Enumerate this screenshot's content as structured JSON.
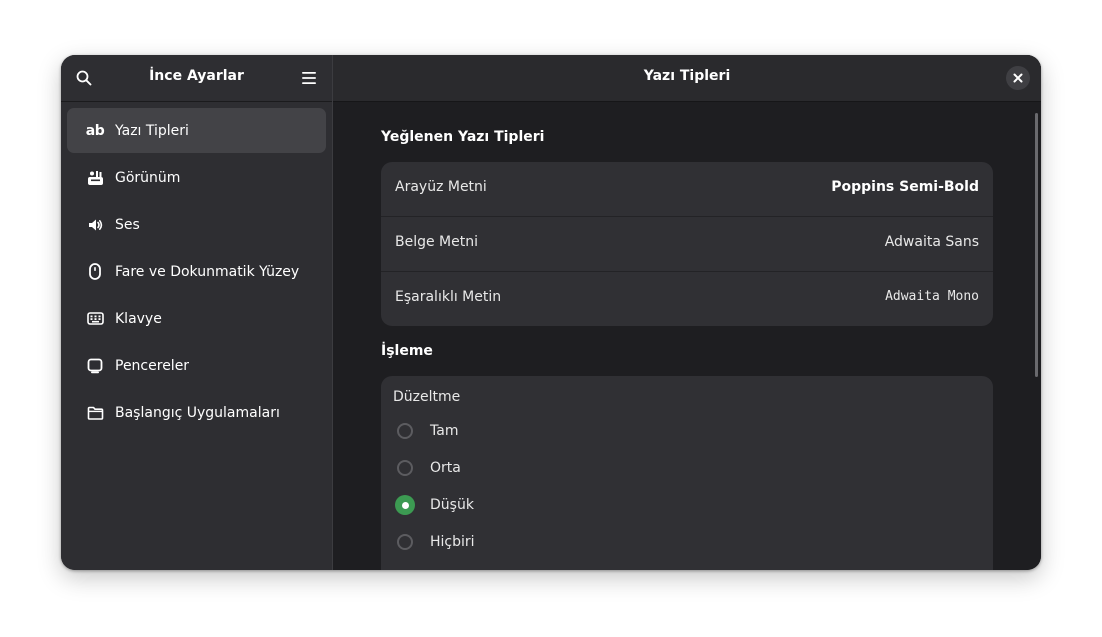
{
  "sidebar": {
    "title": "İnce Ayarlar",
    "search_icon": "search-icon",
    "menu_icon": "hamburger-menu-icon",
    "items": [
      {
        "label": "Yazı Tipleri",
        "icon": "font-ab-icon",
        "selected": true
      },
      {
        "label": "Görünüm",
        "icon": "appearance-icon",
        "selected": false
      },
      {
        "label": "Ses",
        "icon": "speaker-icon",
        "selected": false
      },
      {
        "label": "Fare ve Dokunmatik Yüzey",
        "icon": "mouse-icon",
        "selected": false
      },
      {
        "label": "Klavye",
        "icon": "keyboard-icon",
        "selected": false
      },
      {
        "label": "Pencereler",
        "icon": "window-icon",
        "selected": false
      },
      {
        "label": "Başlangıç Uygulamaları",
        "icon": "folder-icon",
        "selected": false
      }
    ]
  },
  "main": {
    "title": "Yazı Tipleri",
    "close_icon": "close-icon",
    "preferred_fonts": {
      "title": "Yeğlenen Yazı Tipleri",
      "rows": [
        {
          "label": "Arayüz Metni",
          "value": "Poppins Semi-Bold"
        },
        {
          "label": "Belge Metni",
          "value": "Adwaita Sans"
        },
        {
          "label": "Eşaralıklı Metin",
          "value": "Adwaita Mono"
        }
      ]
    },
    "rendering": {
      "title": "İşleme",
      "hinting": {
        "title": "Düzeltme",
        "options": [
          "Tam",
          "Orta",
          "Düşük",
          "Hiçbiri"
        ],
        "selected": "Düşük"
      }
    }
  },
  "colors": {
    "accent": "#3c9a52",
    "window_bg": "#1e1e21",
    "sidebar_bg": "#2e2e32",
    "card_bg": "#303034"
  }
}
